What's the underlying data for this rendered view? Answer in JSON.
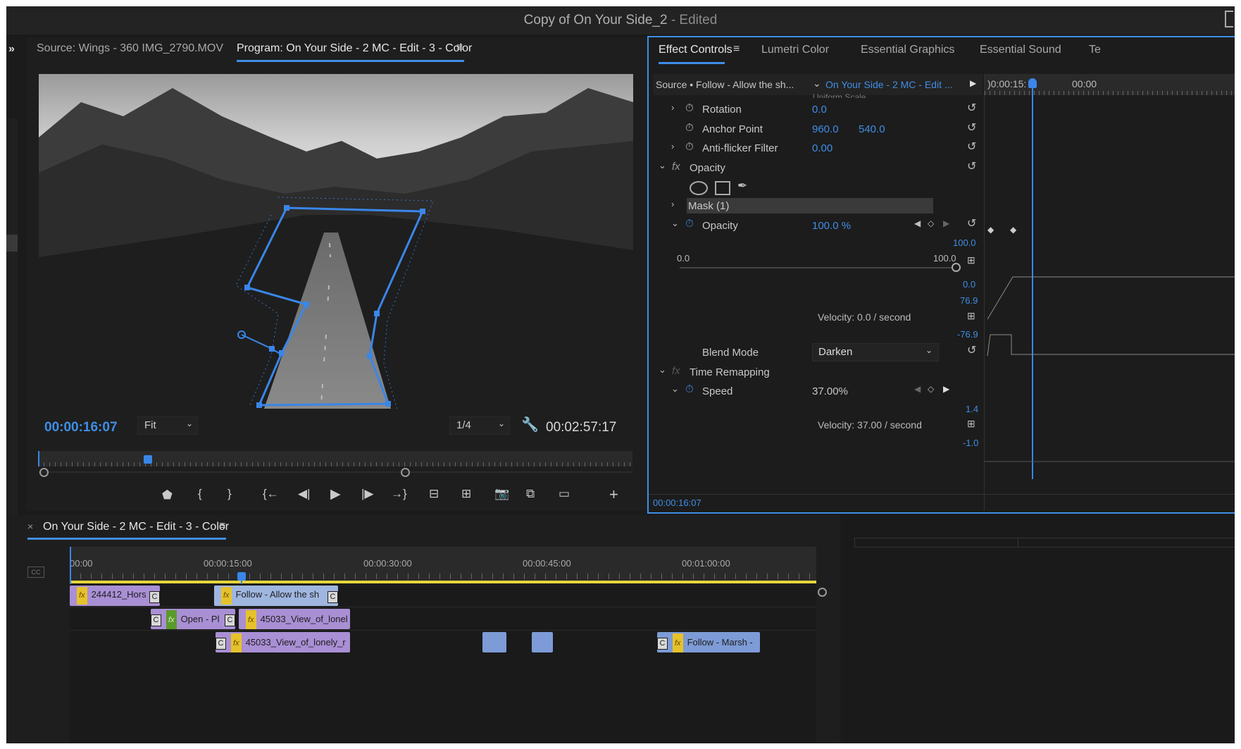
{
  "app": {
    "title": "Copy of On Your Side_2",
    "title_suffix": " - Edited"
  },
  "source_monitor": {
    "tab_label": "Source: Wings - 360 IMG_2790.MOV",
    "expand_icon": "double-chevron-right"
  },
  "program_monitor": {
    "tab_label": "Program: On Your Side - 2 MC  - Edit - 3 - Color",
    "current_time": "00:00:16:07",
    "fit_value": "Fit",
    "resolution_value": "1/4",
    "duration": "00:02:57:17"
  },
  "transport": {
    "icons": [
      "marker-icon",
      "mark-in-icon",
      "mark-out-icon",
      "go-to-in-icon",
      "step-back-icon",
      "play-icon",
      "step-forward-icon",
      "go-to-out-icon",
      "lift-icon",
      "extract-icon",
      "export-frame-icon",
      "comparison-view-icon",
      "proxy-toggle-icon",
      "add-button-icon"
    ]
  },
  "effect_panel": {
    "tabs": [
      "Effect Controls",
      "Lumetri Color",
      "Essential Graphics",
      "Essential Sound",
      "Te"
    ],
    "source_label": "Source • Follow - Allow the sh...",
    "sequence_label": "On Your Side - 2 MC  - Edit ...",
    "mini_timeline": {
      "t1": ")0:00:15:",
      "t2": "00:00"
    },
    "clipped_label": "Uniform Scale",
    "rows": {
      "rotation": {
        "label": "Rotation",
        "value": "0.0"
      },
      "anchor": {
        "label": "Anchor Point",
        "x": "960.0",
        "y": "540.0"
      },
      "antiflicker": {
        "label": "Anti-flicker Filter",
        "value": "0.00"
      },
      "opacity_header": {
        "label": "Opacity"
      },
      "mask": {
        "label": "Mask (1)"
      },
      "opacity": {
        "label": "Opacity",
        "value": "100.0 %"
      },
      "opacity_graph": {
        "top": "100.0",
        "bottom": "0.0",
        "slider_min": "0.0",
        "slider_max": "100.0",
        "slider_value_percent": 100
      },
      "opacity_velocity": {
        "top": "76.9",
        "text": "Velocity: 0.0 / second",
        "bottom": "-76.9"
      },
      "blend": {
        "label": "Blend Mode",
        "value": "Darken"
      },
      "time_remap": {
        "label": "Time Remapping"
      },
      "speed": {
        "label": "Speed",
        "value": "37.00%"
      },
      "speed_velocity": {
        "top": "1.4",
        "text": "Velocity: 37.00 / second",
        "bottom": "-1.0"
      }
    },
    "footer_time": "00:00:16:07"
  },
  "timeline": {
    "tab_label": "On Your Side - 2 MC  - Edit - 3 - Color",
    "close_icon": "×",
    "ruler": [
      "00:00",
      "00:00:15:00",
      "00:00:30:00",
      "00:00:45:00",
      "00:01:00:00"
    ],
    "clips": {
      "c1": "244412_Hors",
      "c2": "Follow - Allow the sh",
      "c3": "Open - Pl",
      "c4": "45033_View_of_lonel",
      "c5": "45033_View_of_lonely_r",
      "c6": "Follow - Marsh -"
    },
    "cc_label": "CC"
  },
  "colors": {
    "accent": "#3f8ee6",
    "panel_bg": "#1e1e1e",
    "clip_purple": "#a98fd4",
    "clip_blue": "#7d9bd6",
    "playhead_yellow": "#e6d63a"
  }
}
